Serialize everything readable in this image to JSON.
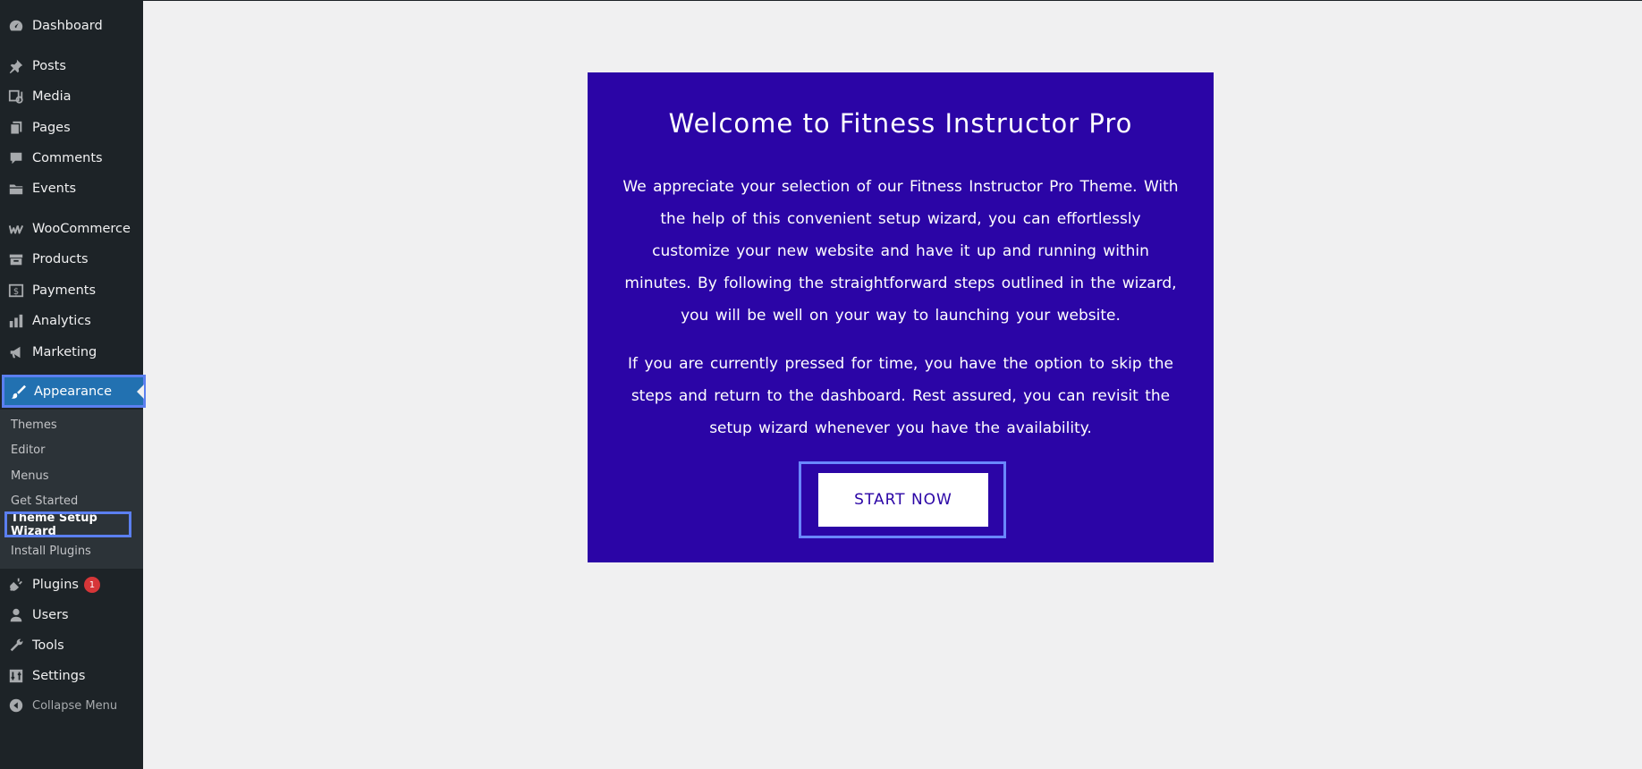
{
  "sidebar": {
    "items": [
      {
        "name": "dashboard",
        "label": "Dashboard",
        "icon": "dashboard-icon"
      },
      {
        "name": "posts",
        "label": "Posts",
        "icon": "pin-icon"
      },
      {
        "name": "media",
        "label": "Media",
        "icon": "media-icon"
      },
      {
        "name": "pages",
        "label": "Pages",
        "icon": "pages-icon"
      },
      {
        "name": "comments",
        "label": "Comments",
        "icon": "comment-icon"
      },
      {
        "name": "events",
        "label": "Events",
        "icon": "folder-icon"
      },
      {
        "name": "woocommerce",
        "label": "WooCommerce",
        "icon": "woocommerce-icon"
      },
      {
        "name": "products",
        "label": "Products",
        "icon": "archive-icon"
      },
      {
        "name": "payments",
        "label": "Payments",
        "icon": "payment-icon"
      },
      {
        "name": "analytics",
        "label": "Analytics",
        "icon": "bar-chart-icon"
      },
      {
        "name": "marketing",
        "label": "Marketing",
        "icon": "megaphone-icon"
      },
      {
        "name": "appearance",
        "label": "Appearance",
        "icon": "paintbrush-icon",
        "active": true
      }
    ],
    "submenu": [
      {
        "name": "themes",
        "label": "Themes"
      },
      {
        "name": "editor",
        "label": "Editor"
      },
      {
        "name": "menus",
        "label": "Menus"
      },
      {
        "name": "get-started",
        "label": "Get Started"
      },
      {
        "name": "theme-setup-wizard",
        "label": "Theme Setup Wizard",
        "current": true
      },
      {
        "name": "install-plugins",
        "label": "Install Plugins"
      }
    ],
    "bottom_items": [
      {
        "name": "plugins",
        "label": "Plugins",
        "icon": "plug-icon",
        "badge": "1"
      },
      {
        "name": "users",
        "label": "Users",
        "icon": "user-icon"
      },
      {
        "name": "tools",
        "label": "Tools",
        "icon": "wrench-icon"
      },
      {
        "name": "settings",
        "label": "Settings",
        "icon": "settings-icon"
      }
    ],
    "collapse_label": "Collapse Menu"
  },
  "wizard": {
    "title": "Welcome to Fitness Instructor Pro",
    "paragraph1": "We appreciate your selection of our Fitness Instructor Pro Theme. With the help of this convenient setup wizard, you can effortlessly customize your new website and have it up and running within minutes. By following the straightforward steps outlined in the wizard, you will be well on your way to launching your website.",
    "paragraph2": "If you are currently pressed for time, you have the option to skip the steps and return to the dashboard. Rest assured, you can revisit the setup wizard whenever you have the availability.",
    "button_label": "START NOW"
  },
  "colors": {
    "sidebar_bg": "#1d2327",
    "submenu_bg": "#2c3338",
    "active_bg": "#2271b1",
    "focus_outline": "#5b7ff0",
    "card_bg": "#2b05a6",
    "badge_bg": "#d63638",
    "page_bg": "#f0f0f1"
  }
}
